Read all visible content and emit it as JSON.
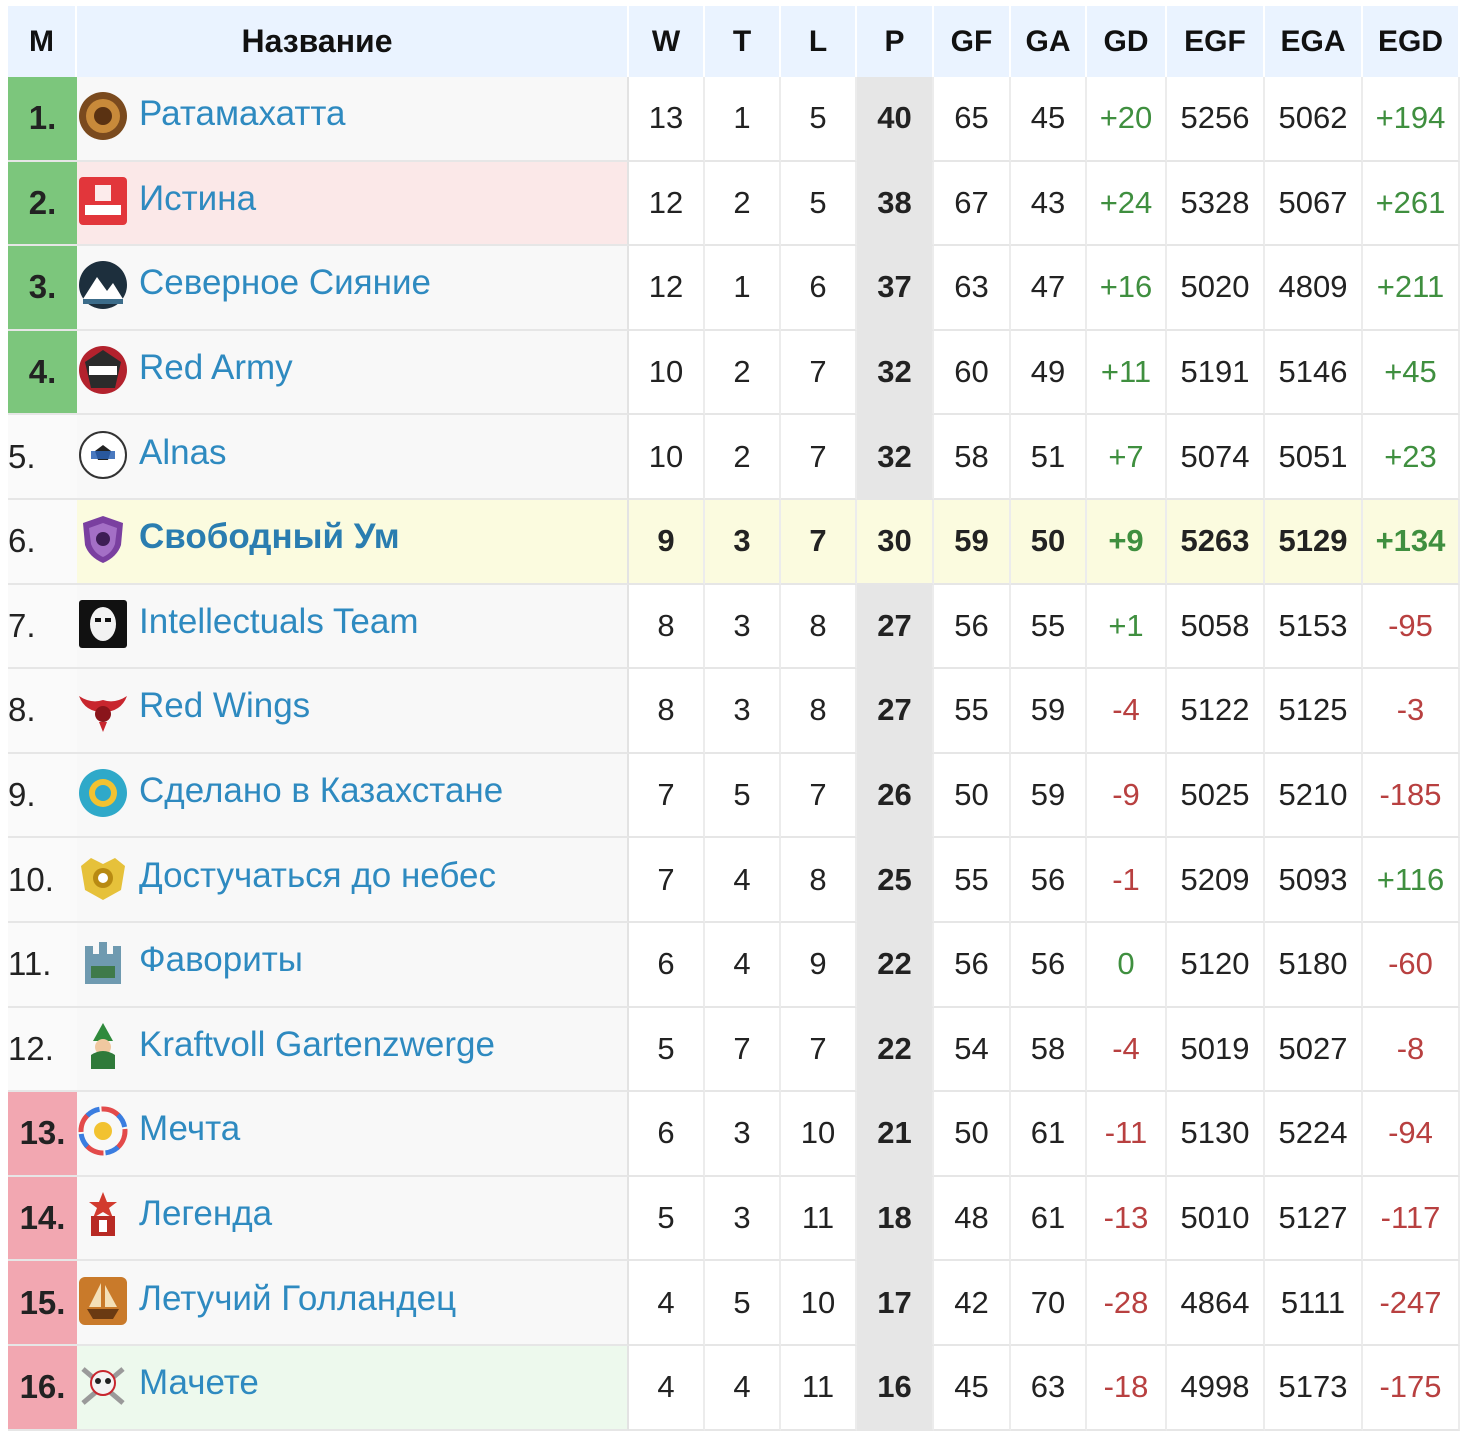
{
  "headers": {
    "pos": "M",
    "name": "Название",
    "w": "W",
    "t": "T",
    "l": "L",
    "p": "P",
    "gf": "GF",
    "ga": "GA",
    "gd": "GD",
    "egf": "EGF",
    "ega": "EGA",
    "egd": "EGD"
  },
  "colors": {
    "qualify": "#7cc67c",
    "relegate": "#f2a7b1",
    "team_link": "#2e8ac0",
    "positive": "#3f8f3f",
    "negative": "#b84040",
    "highlight_row": "#fbfbdf"
  },
  "rows": [
    {
      "pos": "1.",
      "team": "Ратамахатта",
      "logo": "rattan-shield-icon",
      "w": "13",
      "t": "1",
      "l": "5",
      "p": "40",
      "gf": "65",
      "ga": "45",
      "gd": "+20",
      "egf": "5256",
      "ega": "5062",
      "egd": "+194",
      "zone": "qualify"
    },
    {
      "pos": "2.",
      "team": "Истина",
      "logo": "truth-logo-icon",
      "w": "12",
      "t": "2",
      "l": "5",
      "p": "38",
      "gf": "67",
      "ga": "43",
      "gd": "+24",
      "egf": "5328",
      "ega": "5067",
      "egd": "+261",
      "zone": "qualify"
    },
    {
      "pos": "3.",
      "team": "Северное Сияние",
      "logo": "mountain-logo-icon",
      "w": "12",
      "t": "1",
      "l": "6",
      "p": "37",
      "gf": "63",
      "ga": "47",
      "gd": "+16",
      "egf": "5020",
      "ega": "4809",
      "egd": "+211",
      "zone": "qualify"
    },
    {
      "pos": "4.",
      "team": "Red Army",
      "logo": "army-badge-icon",
      "w": "10",
      "t": "2",
      "l": "7",
      "p": "32",
      "gf": "60",
      "ga": "49",
      "gd": "+11",
      "egf": "5191",
      "ega": "5146",
      "egd": "+45",
      "zone": "qualify"
    },
    {
      "pos": "5.",
      "team": "Alnas",
      "logo": "soccer-ball-icon",
      "w": "10",
      "t": "2",
      "l": "7",
      "p": "32",
      "gf": "58",
      "ga": "51",
      "gd": "+7",
      "egf": "5074",
      "ega": "5051",
      "egd": "+23",
      "zone": "none"
    },
    {
      "pos": "6.",
      "team": "Свободный Ум",
      "logo": "purple-shield-icon",
      "w": "9",
      "t": "3",
      "l": "7",
      "p": "30",
      "gf": "59",
      "ga": "50",
      "gd": "+9",
      "egf": "5263",
      "ega": "5129",
      "egd": "+134",
      "zone": "highlight"
    },
    {
      "pos": "7.",
      "team": "Intellectuals Team",
      "logo": "masked-face-icon",
      "w": "8",
      "t": "3",
      "l": "8",
      "p": "27",
      "gf": "56",
      "ga": "55",
      "gd": "+1",
      "egf": "5058",
      "ega": "5153",
      "egd": "-95",
      "zone": "none"
    },
    {
      "pos": "8.",
      "team": "Red Wings",
      "logo": "red-wings-icon",
      "w": "8",
      "t": "3",
      "l": "8",
      "p": "27",
      "gf": "55",
      "ga": "59",
      "gd": "-4",
      "egf": "5122",
      "ega": "5125",
      "egd": "-3",
      "zone": "none"
    },
    {
      "pos": "9.",
      "team": "Сделано в Казахстане",
      "logo": "kazakh-emblem-icon",
      "w": "7",
      "t": "5",
      "l": "7",
      "p": "26",
      "gf": "50",
      "ga": "59",
      "gd": "-9",
      "egf": "5025",
      "ega": "5210",
      "egd": "-185",
      "zone": "none"
    },
    {
      "pos": "10.",
      "team": "Достучаться до небес",
      "logo": "gold-crest-icon",
      "w": "7",
      "t": "4",
      "l": "8",
      "p": "25",
      "gf": "55",
      "ga": "56",
      "gd": "-1",
      "egf": "5209",
      "ega": "5093",
      "egd": "+116",
      "zone": "none"
    },
    {
      "pos": "11.",
      "team": "Фавориты",
      "logo": "castle-crest-icon",
      "w": "6",
      "t": "4",
      "l": "9",
      "p": "22",
      "gf": "56",
      "ga": "56",
      "gd": "0",
      "egf": "5120",
      "ega": "5180",
      "egd": "-60",
      "zone": "none"
    },
    {
      "pos": "12.",
      "team": "Kraftvoll Gartenzwerge",
      "logo": "garden-gnome-icon",
      "w": "5",
      "t": "7",
      "l": "7",
      "p": "22",
      "gf": "54",
      "ga": "58",
      "gd": "-4",
      "egf": "5019",
      "ega": "5027",
      "egd": "-8",
      "zone": "none"
    },
    {
      "pos": "13.",
      "team": "Мечта",
      "logo": "colorful-ring-icon",
      "w": "6",
      "t": "3",
      "l": "10",
      "p": "21",
      "gf": "50",
      "ga": "61",
      "gd": "-11",
      "egf": "5130",
      "ega": "5224",
      "egd": "-94",
      "zone": "relegate"
    },
    {
      "pos": "14.",
      "team": "Легенда",
      "logo": "legend-crest-icon",
      "w": "5",
      "t": "3",
      "l": "11",
      "p": "18",
      "gf": "48",
      "ga": "61",
      "gd": "-13",
      "egf": "5010",
      "ega": "5127",
      "egd": "-117",
      "zone": "relegate"
    },
    {
      "pos": "15.",
      "team": "Летучий Голландец",
      "logo": "ship-icon",
      "w": "4",
      "t": "5",
      "l": "10",
      "p": "17",
      "gf": "42",
      "ga": "70",
      "gd": "-28",
      "egf": "4864",
      "ega": "5111",
      "egd": "-247",
      "zone": "relegate"
    },
    {
      "pos": "16.",
      "team": "Мачете",
      "logo": "skull-crossbones-icon",
      "w": "4",
      "t": "4",
      "l": "11",
      "p": "16",
      "gf": "45",
      "ga": "63",
      "gd": "-18",
      "egf": "4998",
      "ega": "5173",
      "egd": "-175",
      "zone": "relegate"
    }
  ]
}
